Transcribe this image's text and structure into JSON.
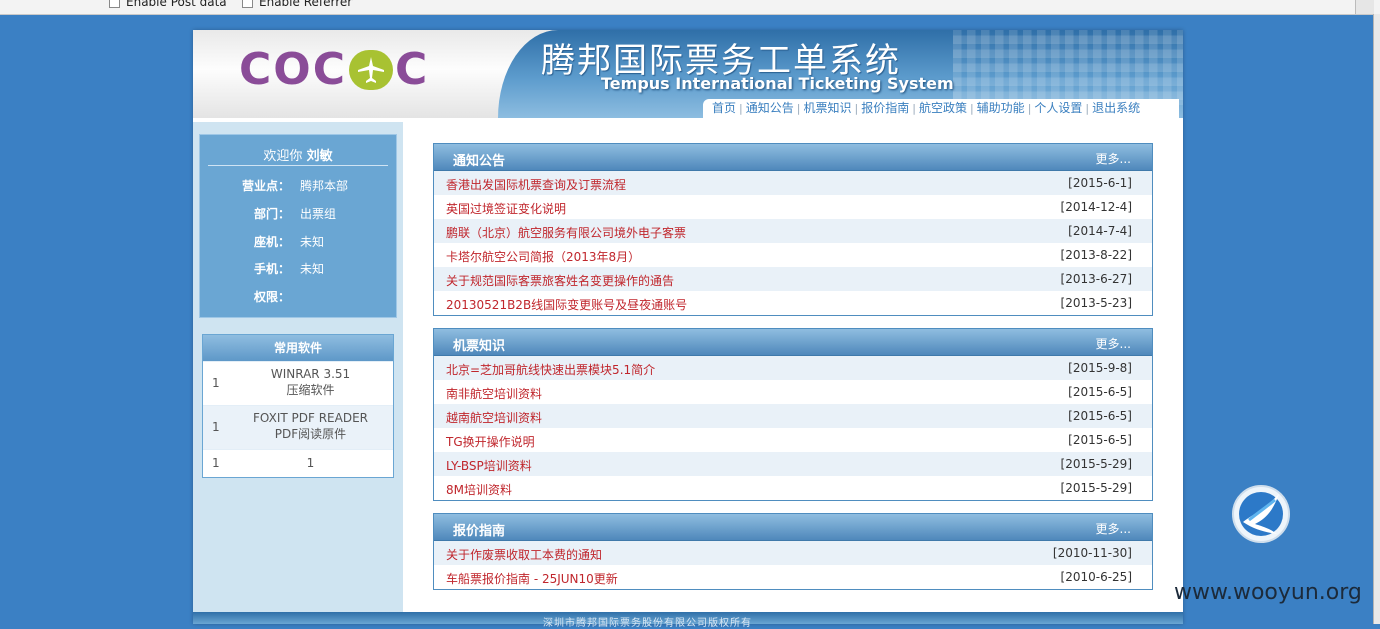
{
  "browser_bar": {
    "opt_post": "Enable Post data",
    "opt_referrer": "Enable Referrer"
  },
  "header": {
    "logo_left": "COC",
    "logo_right": "C",
    "title_cn": "腾邦国际票务工单系统",
    "title_en": "Tempus International Ticketing System",
    "nav": [
      "首页",
      "通知公告",
      "机票知识",
      "报价指南",
      "航空政策",
      "辅助功能",
      "个人设置",
      "退出系统"
    ]
  },
  "welcome": {
    "greeting": "欢迎你",
    "user": "刘敏",
    "rows": [
      {
        "k": "营业点：",
        "v": "腾邦本部"
      },
      {
        "k": "部门：",
        "v": "出票组"
      },
      {
        "k": "座机：",
        "v": "未知"
      },
      {
        "k": "手机：",
        "v": "未知"
      },
      {
        "k": "权限：",
        "v": ""
      }
    ]
  },
  "software": {
    "title": "常用软件",
    "rows": [
      {
        "n": "1",
        "l1": "WINRAR 3.51",
        "l2": "压缩软件"
      },
      {
        "n": "1",
        "l1": "FOXIT PDF READER",
        "l2": "PDF阅读原件"
      },
      {
        "n": "1",
        "l1": "1",
        "l2": ""
      }
    ]
  },
  "panels": [
    {
      "title": "通知公告",
      "more": "更多...",
      "items": [
        {
          "t": "香港出发国际机票查询及订票流程",
          "d": "[2015-6-1]"
        },
        {
          "t": "英国过境签证变化说明",
          "d": "[2014-12-4]"
        },
        {
          "t": "鹏联（北京）航空服务有限公司境外电子客票",
          "d": "[2014-7-4]"
        },
        {
          "t": "卡塔尔航空公司简报（2013年8月）",
          "d": "[2013-8-22]"
        },
        {
          "t": "关于规范国际客票旅客姓名变更操作的通告",
          "d": "[2013-6-27]"
        },
        {
          "t": "20130521B2B线国际变更账号及昼夜通账号",
          "d": "[2013-5-23]"
        }
      ]
    },
    {
      "title": "机票知识",
      "more": "更多...",
      "items": [
        {
          "t": "北京=芝加哥航线快速出票模块5.1简介",
          "d": "[2015-9-8]"
        },
        {
          "t": "南非航空培训资料",
          "d": "[2015-6-5]"
        },
        {
          "t": "越南航空培训资料",
          "d": "[2015-6-5]"
        },
        {
          "t": "TG换开操作说明",
          "d": "[2015-6-5]"
        },
        {
          "t": "LY-BSP培训资料",
          "d": "[2015-5-29]"
        },
        {
          "t": "8M培训资料",
          "d": "[2015-5-29]"
        }
      ]
    },
    {
      "title": "报价指南",
      "more": "更多...",
      "items": [
        {
          "t": "关于作废票收取工本费的通知",
          "d": "[2010-11-30]"
        },
        {
          "t": "车船票报价指南 - 25JUN10更新",
          "d": "[2010-6-25]"
        }
      ]
    }
  ],
  "footer_text": "深圳市腾邦国际票务股份有限公司版权所有",
  "watermark": "www.wooyun.org",
  "colors": {
    "accent": "#3b80c4",
    "link_red": "#c0262c",
    "panel_head": "#4f88bb"
  }
}
